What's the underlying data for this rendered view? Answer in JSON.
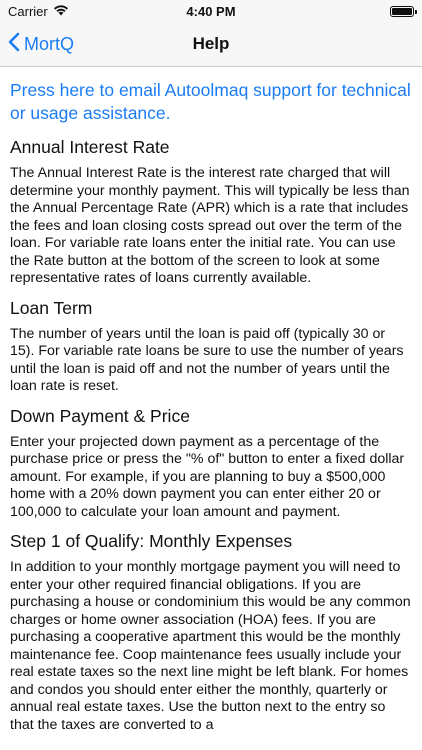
{
  "status_bar": {
    "carrier": "Carrier",
    "time": "4:40 PM"
  },
  "nav": {
    "back_label": "MortQ",
    "title": "Help"
  },
  "email_link": "Press here to email Autoolmaq support for technical or usage assistance.",
  "sections": [
    {
      "heading": "Annual Interest Rate",
      "body": "The Annual Interest Rate is the interest rate charged that will determine your monthly payment.  This will typically be less than the Annual Percentage Rate (APR) which is a rate that includes the fees and loan closing costs spread out over the term of the loan.  For variable rate loans enter the initial rate.  You can use the Rate button at the bottom of the screen to look at some representative rates of loans currently available."
    },
    {
      "heading": "Loan Term",
      "body": "The number of years until the loan is paid off (typically 30 or 15).  For variable rate loans be sure to use the number of years until the loan is paid off and not the number of years until the loan rate is reset."
    },
    {
      "heading": "Down Payment & Price",
      "body": "Enter your projected down payment as a percentage of the purchase price or press the \"% of\" button to enter a fixed dollar amount.  For example, if you are planning to buy a $500,000 home with a 20% down payment you can enter either 20 or 100,000 to calculate your loan amount and payment."
    },
    {
      "heading": "Step 1 of Qualify: Monthly Expenses",
      "body": "In addition to your monthly mortgage payment you will need to enter your other required financial obligations.  If you are purchasing a house or condominium this would be any common charges or home owner association (HOA) fees.  If you are purchasing a cooperative apartment this would be the monthly maintenance fee.  Coop maintenance fees usually include your real estate taxes so the next line might be left blank.  For homes and condos you should enter either the monthly, quarterly or annual real estate  taxes.  Use the button next to the entry so that the taxes are converted to a"
    }
  ],
  "colors": {
    "accent": "#1a7cf5",
    "nav_background": "#f7f7f7",
    "text": "#111111"
  },
  "icons": {
    "wifi": "wifi-icon",
    "battery": "battery-icon",
    "back": "chevron-left-icon"
  }
}
